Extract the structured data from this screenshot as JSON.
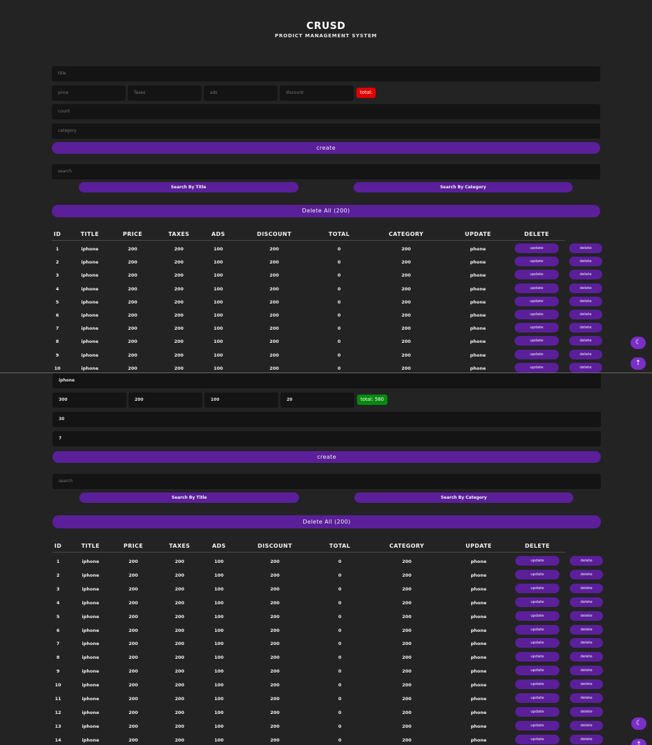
{
  "app": {
    "title": "CRUSD",
    "subtitle": "PRODICT MANAGEMENT SYSTEM"
  },
  "top_form": {
    "title_placeholder": "title",
    "price_placeholder": "price",
    "taxes_placeholder": "Taxes",
    "ads_placeholder": "ads",
    "discount_placeholder": "discount",
    "total_label": "total:",
    "count_placeholder": "count",
    "category_placeholder": "category",
    "create_label": "create",
    "search_placeholder": "search",
    "search_title_label": "Search By Title",
    "search_category_label": "Search By Category",
    "delete_all_label": "Delete All (200)"
  },
  "bottom_form": {
    "title_value": "iphone",
    "price_value": "300",
    "taxes_value": "200",
    "ads_value": "100",
    "discount_value": "20",
    "total_label": "total: 580",
    "count_value": "30",
    "category_value": "7",
    "create_label": "create",
    "search_placeholder": "search",
    "search_title_label": "Search By Title",
    "search_category_label": "Search By Category",
    "delete_all_label": "Delete All (200)"
  },
  "table": {
    "columns": [
      "ID",
      "TITLE",
      "PRICE",
      "TAXES",
      "ADS",
      "DISCOUNT",
      "TOTAL",
      "CATEGORY",
      "UPDATE",
      "DELETE"
    ],
    "update_label": "update",
    "delete_label": "delete",
    "row_template": {
      "title": "iphone",
      "price": "200",
      "taxes": "200",
      "ads": "100",
      "discount": "200",
      "total": "0",
      "category": "200",
      "update_col": "phone"
    },
    "top_row_ids": [
      "1",
      "2",
      "3",
      "4",
      "5",
      "6",
      "7",
      "8",
      "9",
      "10"
    ],
    "bottom_row_ids": [
      "1",
      "2",
      "3",
      "4",
      "5",
      "6",
      "7",
      "8",
      "9",
      "10",
      "11",
      "12",
      "13",
      "14"
    ]
  },
  "floating": {
    "theme_icon": "moon-icon",
    "scroll_icon": "arrow-up-icon",
    "theme_glyph": "☾",
    "scroll_glyph": "↑"
  },
  "colors": {
    "accent": "#5b1f9a",
    "total_empty": "#e00000",
    "total_filled": "#06880e",
    "background": "#232323",
    "input": "#141414"
  }
}
